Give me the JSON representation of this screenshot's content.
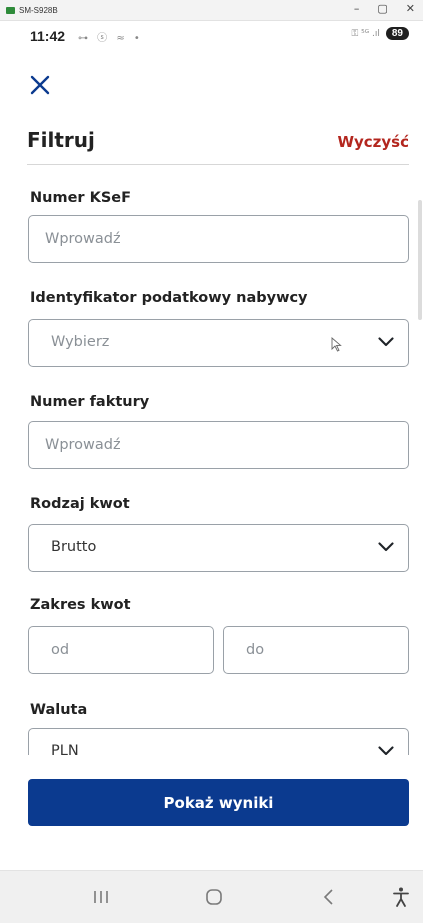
{
  "window": {
    "title": "SM-S928B",
    "min_glyph": "–",
    "max_glyph": "▢",
    "close_glyph": "✕"
  },
  "status_bar": {
    "time": "11:42",
    "battery": "89",
    "left_icons": "⊶ ⓢ ≈ •",
    "right_icons": "⚿ ⁵ᴳ .ıl"
  },
  "filter": {
    "title": "Filtruj",
    "clear_label": "Wyczyść"
  },
  "fields": {
    "ksef": {
      "label": "Numer KSeF",
      "placeholder": "Wprowadź"
    },
    "tax_id": {
      "label": "Identyfikator podatkowy nabywcy",
      "placeholder": "Wybierz"
    },
    "invoice": {
      "label": "Numer faktury",
      "placeholder": "Wprowadź"
    },
    "amount_type": {
      "label": "Rodzaj kwot",
      "value": "Brutto"
    },
    "amount_range": {
      "label": "Zakres kwot",
      "from_placeholder": "od",
      "to_placeholder": "do"
    },
    "currency": {
      "label": "Waluta",
      "value": "PLN"
    }
  },
  "submit_label": "Pokaż wyniki",
  "nav": {
    "recents": "recents-icon",
    "home": "home-icon",
    "back": "back-icon",
    "accessibility": "accessibility-icon"
  },
  "colors": {
    "primary": "#0b3a8f",
    "clear": "#b3261e",
    "close": "#0b3a8f"
  }
}
